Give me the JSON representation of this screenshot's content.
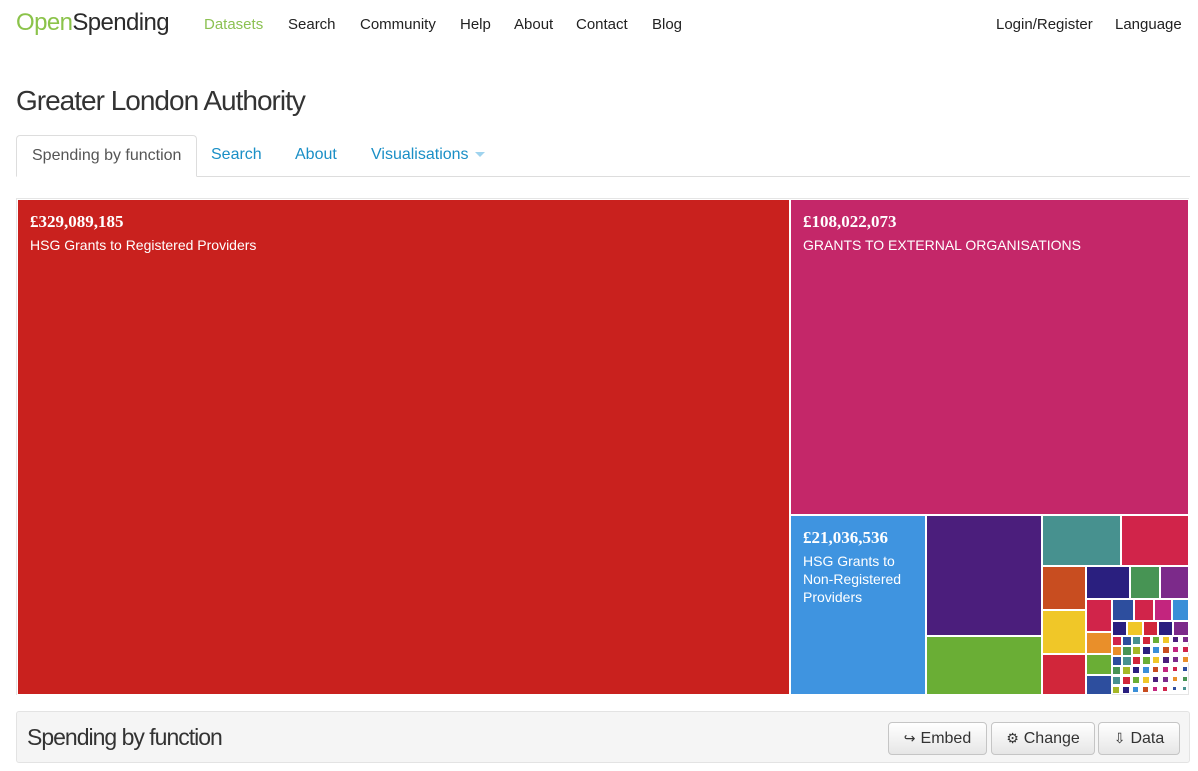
{
  "navbar": {
    "brand_open": "Open",
    "brand_spending": "Spending",
    "items": [
      {
        "label": "Datasets",
        "active": true
      },
      {
        "label": "Search"
      },
      {
        "label": "Community"
      },
      {
        "label": "Help"
      },
      {
        "label": "About"
      },
      {
        "label": "Contact"
      },
      {
        "label": "Blog"
      }
    ],
    "login_label": "Login/Register",
    "language_label": "Language"
  },
  "page": {
    "title": "Greater London Authority"
  },
  "tabs": [
    {
      "label": "Spending by function",
      "active": true
    },
    {
      "label": "Search"
    },
    {
      "label": "About"
    },
    {
      "label": "Visualisations",
      "dropdown": true
    }
  ],
  "treemap": {
    "tiles": [
      {
        "amount": "£329,089,185",
        "label": "HSG Grants to Registered Providers",
        "color": "#c9211e"
      },
      {
        "amount": "£108,022,073",
        "label": "GRANTS TO EXTERNAL ORGANISATIONS",
        "color": "#c42769"
      },
      {
        "amount": "£21,036,536",
        "label": "HSG Grants to Non-Registered Providers",
        "color": "#3f94e0"
      }
    ],
    "small_tile_colors": [
      "#4b1e7c",
      "#6aae35",
      "#47918f",
      "#d1244a",
      "#c84d20",
      "#2a1f7f",
      "#479454",
      "#7c2a8a",
      "#f0c728",
      "#d1263a",
      "#2d4e9e",
      "#c3257e",
      "#3a8fd8",
      "#a5b726",
      "#e98f2a"
    ]
  },
  "footer": {
    "title": "Spending by function",
    "buttons": {
      "embed": "Embed",
      "change": "Change",
      "data": "Data"
    }
  }
}
